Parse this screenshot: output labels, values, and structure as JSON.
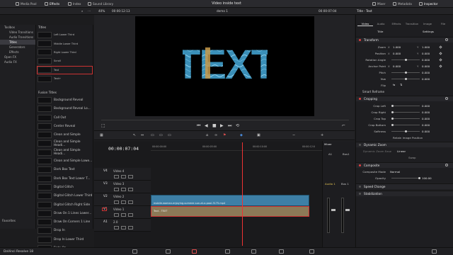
{
  "topbar": {
    "media_pool": "Media Pool",
    "effects": "Effects",
    "index": "Index",
    "sound_library": "Sound Library",
    "project_title": "Video inside text",
    "mixer": "Mixer",
    "metadata": "Metadata",
    "inspector": "Inspector"
  },
  "subbar": {
    "zoom": "40%",
    "source_tc": "00:00:12:13",
    "timeline_name": "demo 1",
    "record_tc": "00:00:07:04",
    "inspector_title": "Title - Text"
  },
  "tree": {
    "items": [
      "Toolbox",
      "Video Transitions",
      "Audio Transitions",
      "Titles",
      "Generators",
      "Effects",
      "Open FX",
      "Audio FX"
    ],
    "favorites": "Favorites"
  },
  "effects": {
    "titles_header": "Titles",
    "titles": [
      "Left Lower Third",
      "Middle Lower Third",
      "Right Lower Third",
      "Scroll",
      "Text",
      "Text+"
    ],
    "fusion_header": "Fusion Titles",
    "fusion": [
      "Background Reveal",
      "Background Reveal Lo...",
      "Call Out",
      "Center Reveal",
      "Clean and Simple",
      "Clean and Simple Headi...",
      "Clean and Simple Headi...",
      "Clean and Simple Lowe...",
      "Dark Box Text",
      "Dark Box Text Lower T...",
      "Digital Glitch",
      "Digital Glitch Lower Third",
      "Digital Glitch Right Side",
      "Draw On 1 Lines Lower...",
      "Draw On Corners 1 Line",
      "Drop In",
      "Drop In Lower Third",
      "Fade On"
    ]
  },
  "viewer": {
    "big_text": "TEXT"
  },
  "timeline": {
    "timecode": "00:00:07:04",
    "ruler": [
      "00:00:00:00",
      "00:00:05:00",
      "00:00:10:00",
      "00:00:12:0"
    ],
    "tracks": [
      {
        "id": "V4",
        "name": "Video 4"
      },
      {
        "id": "V3",
        "name": "Video 3"
      },
      {
        "id": "V2",
        "name": "Video 2"
      },
      {
        "id": "V1",
        "name": "Video 1"
      },
      {
        "id": "A1",
        "name": "2.0"
      }
    ],
    "video_clip": "mobile-woman-enjoying-summer-sun-at-a-pool-3175.mp4",
    "title_clip": "Text - TEXT"
  },
  "mixer": {
    "title": "Mixer",
    "a1": "A1",
    "bus1": "Bus1",
    "audio1": "Audio 1",
    "bus1b": "Bus 1"
  },
  "inspector": {
    "tabs": [
      "Video",
      "Audio",
      "Effects",
      "Transition",
      "Image",
      "File"
    ],
    "subtabs": [
      "Title",
      "Settings"
    ],
    "transform": "Transform",
    "zoom_label": "Zoom",
    "zoom_x": "1.000",
    "zoom_y": "1.000",
    "position_label": "Position",
    "pos_x": "0.000",
    "pos_y": "0.000",
    "rotation_label": "Rotation Angle",
    "rotation": "0.000",
    "anchor_label": "Anchor Point",
    "anchor_x": "0.000",
    "anchor_y": "0.000",
    "pitch_label": "Pitch",
    "pitch": "0.000",
    "yaw_label": "Yaw",
    "yaw": "0.000",
    "flip_label": "Flip",
    "smart_reframe": "Smart Reframe",
    "cropping": "Cropping",
    "crop_left": "Crop Left",
    "crop_right": "Crop Right",
    "crop_top": "Crop Top",
    "crop_bottom": "Crop Bottom",
    "softness": "Softness",
    "crop_val": "0.000",
    "retain": "Retain Image Position",
    "dynamic_zoom": "Dynamic Zoom",
    "dz_ease_label": "Dynamic Zoom Ease",
    "dz_ease": "Linear",
    "swap": "Swap",
    "composite": "Composite",
    "composite_mode_label": "Composite Mode",
    "composite_mode": "Normal",
    "opacity_label": "Opacity",
    "opacity": "100.00",
    "speed_change": "Speed Change",
    "stabilization": "Stabilization"
  },
  "bottom": {
    "brand": "DaVinci Resolve 18"
  },
  "colors": {
    "accent_red": "#e04040",
    "clip_video": "#3d7fa6",
    "clip_title": "#8c7a57"
  }
}
